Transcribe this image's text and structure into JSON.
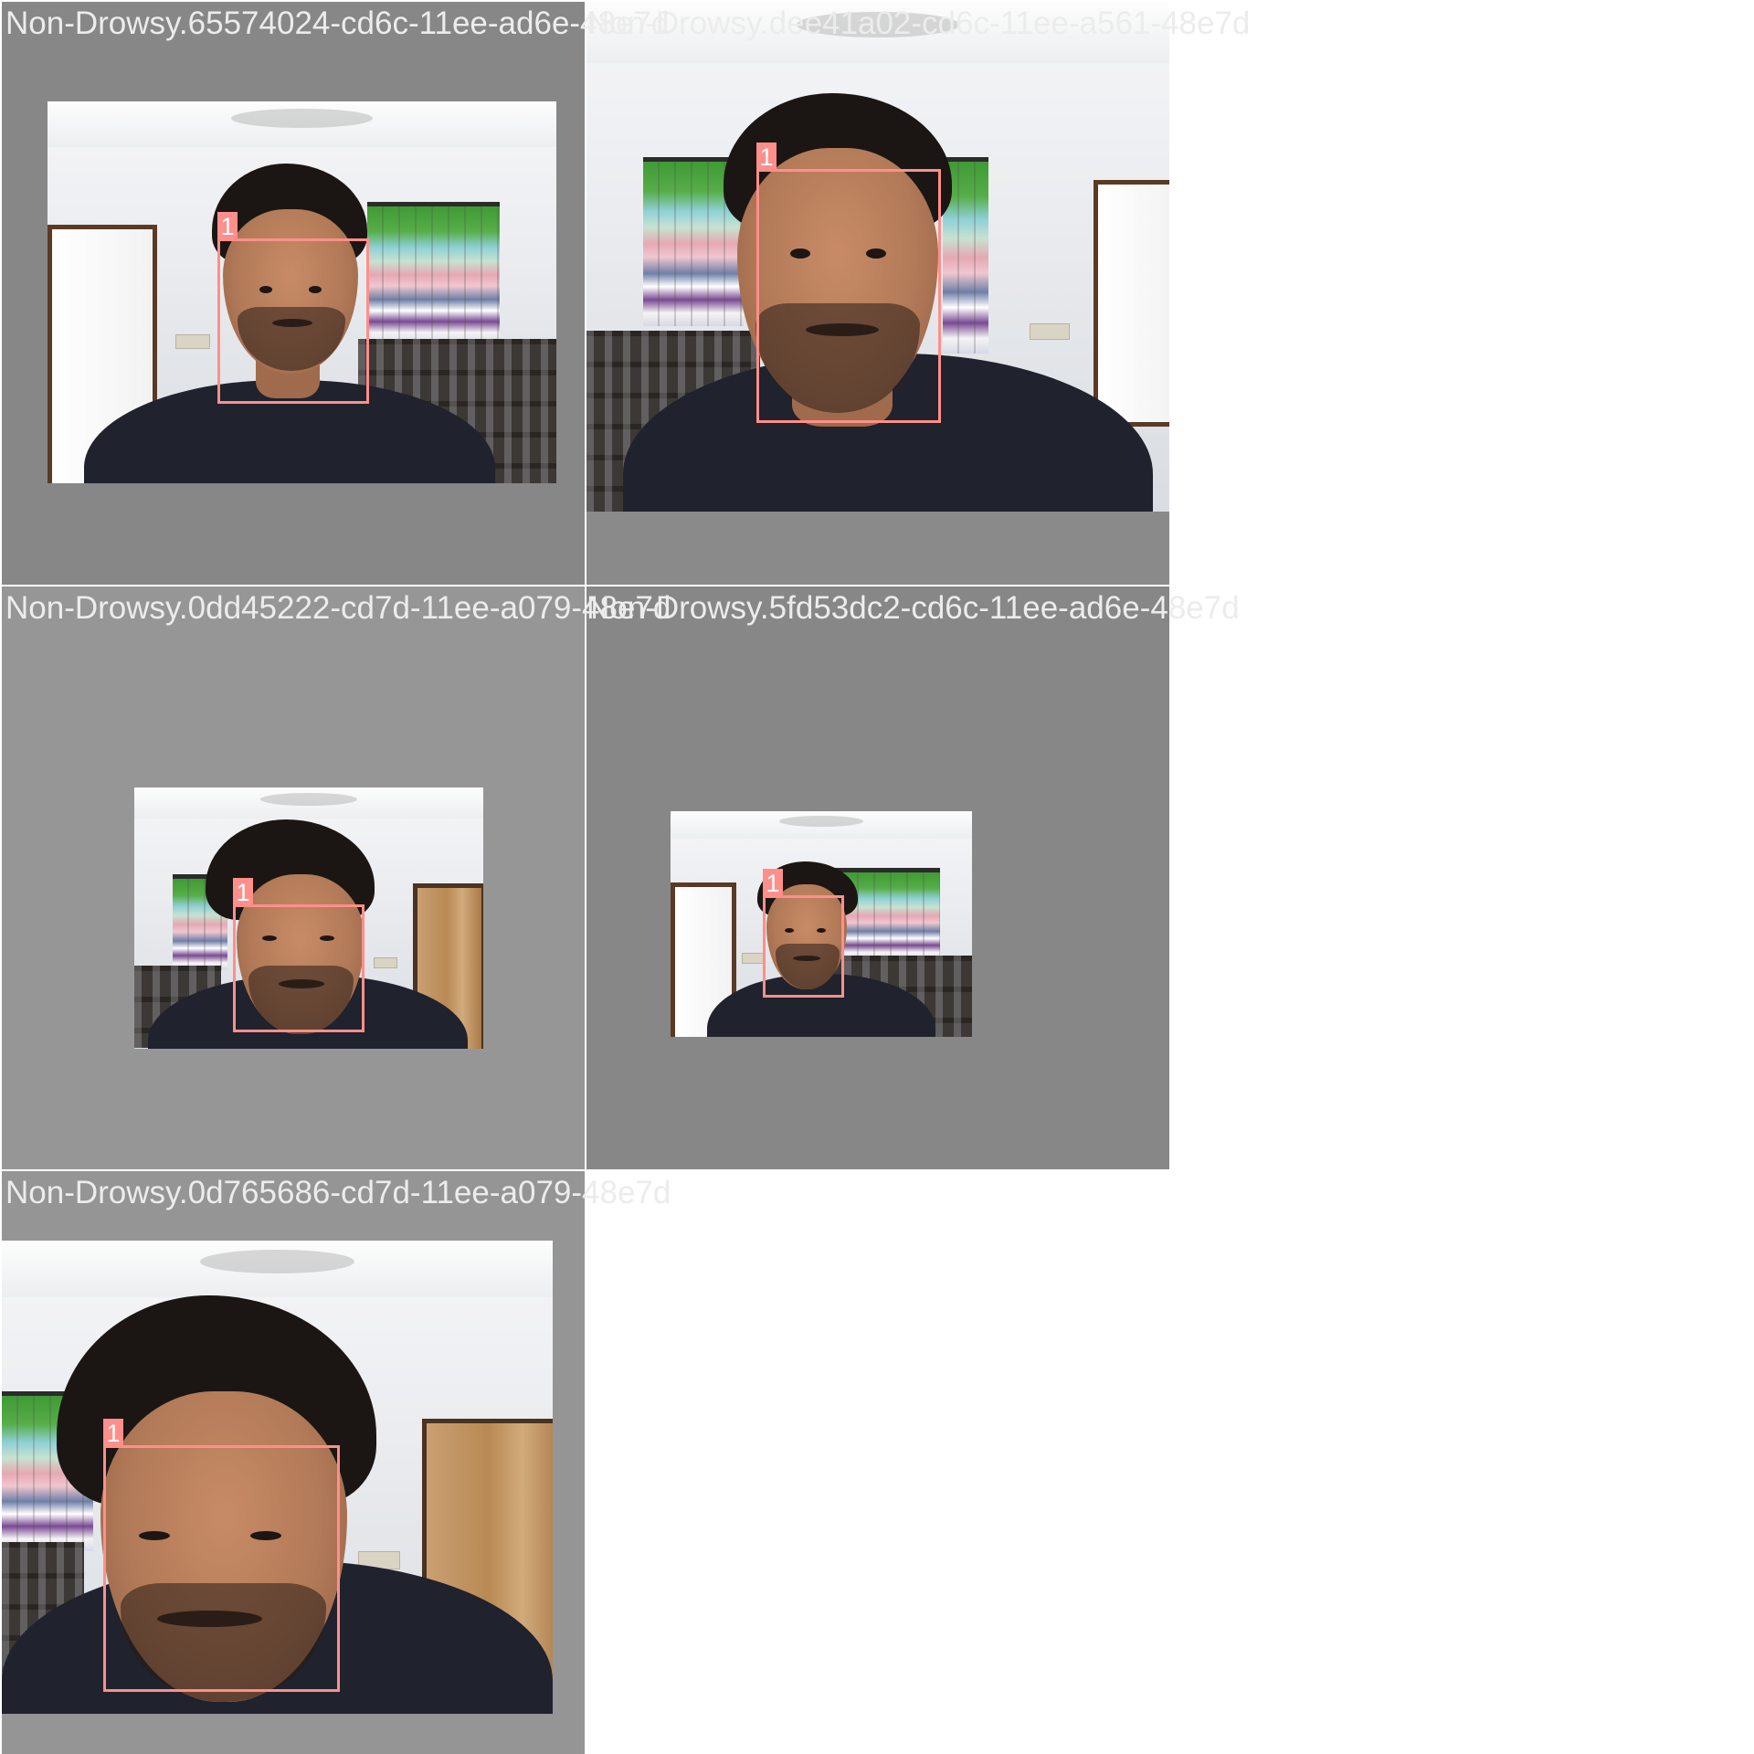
{
  "grid": {
    "tiles": [
      {
        "caption": "Non-Drowsy.65574024-cd6c-11ee-ad6e-48e7d",
        "box_label": "1"
      },
      {
        "caption": "Non-Drowsy.dee41a02-cd6c-11ee-a561-48e7d",
        "box_label": "1"
      },
      {
        "caption": "Non-Drowsy.0dd45222-cd7d-11ee-a079-48e7d",
        "box_label": "1"
      },
      {
        "caption": "Non-Drowsy.5fd53dc2-cd6c-11ee-ad6e-48e7d",
        "box_label": "1"
      },
      {
        "caption": "Non-Drowsy.0d765686-cd7d-11ee-a079-48e7d",
        "box_label": "1"
      }
    ]
  },
  "colors": {
    "bbox": "#ff8f8a",
    "tile_background": "#878787",
    "caption_text": "#ececec"
  }
}
